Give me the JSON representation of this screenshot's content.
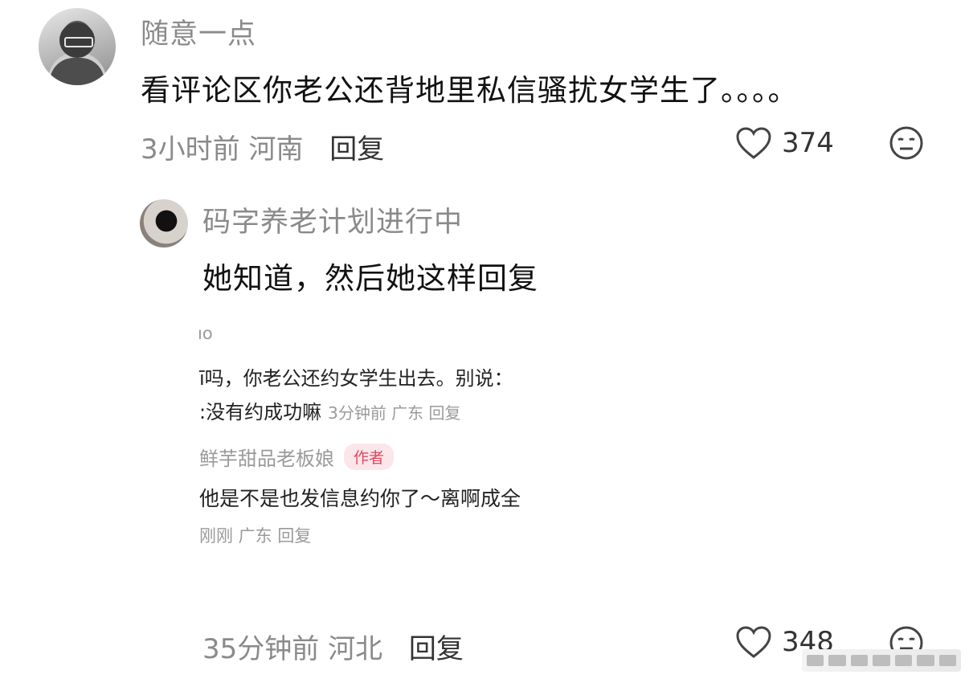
{
  "comment": {
    "username": "随意一点",
    "text": "看评论区你老公还背地里私信骚扰女学生了。。。。",
    "time": "3小时前",
    "location": "河南",
    "reply_label": "回复",
    "likes": "374",
    "icons": {
      "like": "heart-icon",
      "dislike": "meh-face-icon"
    }
  },
  "reply": {
    "username": "码字养老计划进行中",
    "text": "她知道，然后她这样回复",
    "time": "35分钟前",
    "location": "河北",
    "reply_label": "回复",
    "likes": "348",
    "icons": {
      "like": "heart-icon",
      "dislike": "meh-face-icon"
    }
  },
  "embedded_screenshot": {
    "handle_partial": "ıo",
    "line1": "ī吗，你老公还约女学生出去。别说：",
    "line2": ":没有约成功嘛",
    "line2_meta": "3分钟前 广东 回复",
    "author_name": "鲜芋甜品老板娘",
    "author_tag": "作者",
    "author_reply": "他是不是也发信息约你了～离啊成全",
    "author_meta": "刚刚 广东 回复",
    "tag_color": "#e0485e"
  }
}
